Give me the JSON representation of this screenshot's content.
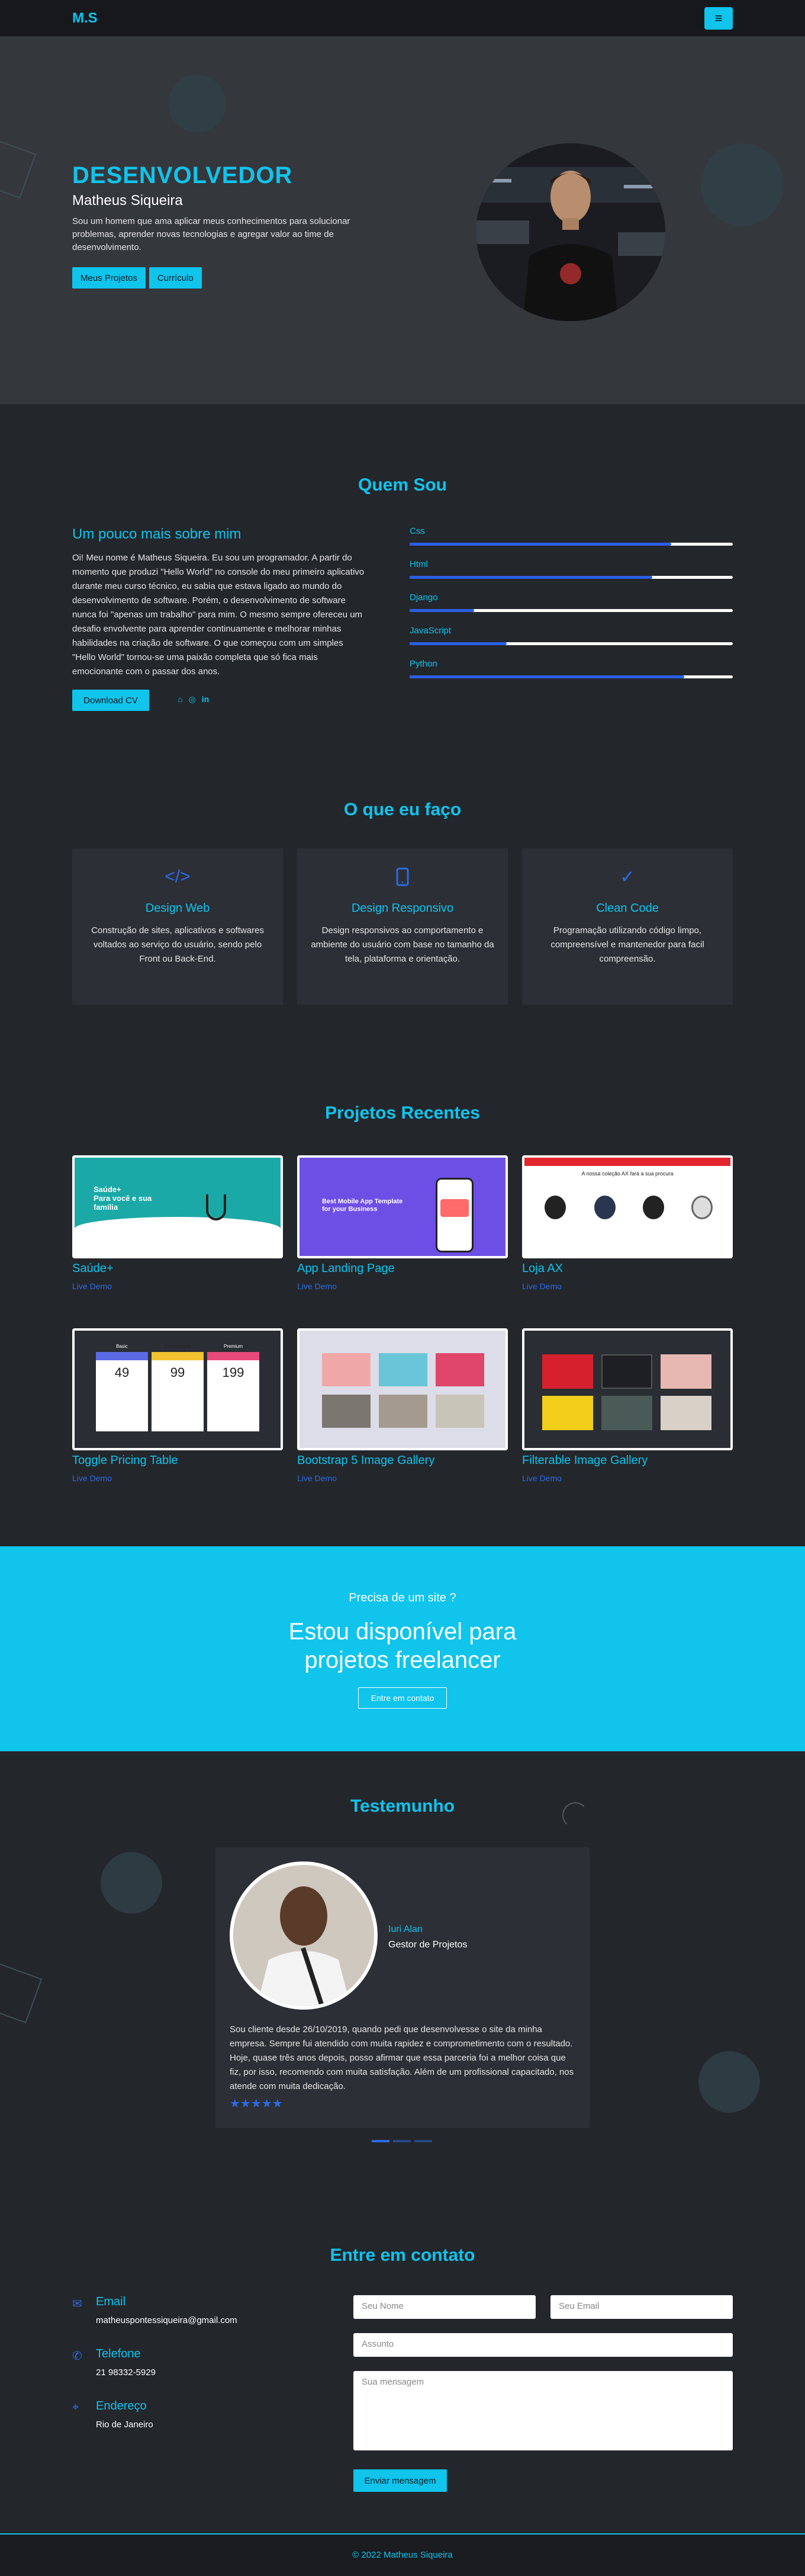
{
  "nav": {
    "logo": "M.S",
    "menu_icon": "hamburger-icon"
  },
  "hero": {
    "title": "DESENVOLVEDOR",
    "name": "Matheus Siqueira",
    "description": "Sou um homem que ama aplicar meus conhecimentos para solucionar problemas, aprender novas tecnologias e agregar valor ao time de desenvolvimento.",
    "buttons": [
      "Meus Projetos",
      "Currículo"
    ]
  },
  "about": {
    "title": "Quem Sou",
    "subtitle": "Um pouco mais sobre mim",
    "body": "Oi! Meu nome é Matheus Siqueira. Eu sou um programador. A partir do momento que produzi \"Hello World\" no console do meu primeiro aplicativo durante meu curso técnico, eu sabia que estava ligado ao mundo do desenvolvimento de software. Porém, o desenvolvimento de software nunca foi \"apenas um trabalho\" para mim. O mesmo sempre ofereceu um desafio envolvente para aprender continuamente e melhorar minhas habilidades na criação de software. O que começou com um simples \"Hello World\" tornou-se uma paixão completa que só fica mais emocionante com o passar dos anos.",
    "cv_button": "Download CV",
    "socials": [
      "github-icon",
      "instagram-icon",
      "linkedin-icon"
    ],
    "skills": [
      {
        "name": "Css",
        "level": 0.81
      },
      {
        "name": "Html",
        "level": 0.75
      },
      {
        "name": "Django",
        "level": 0.2
      },
      {
        "name": "JavaScript",
        "level": 0.3
      },
      {
        "name": "Python",
        "level": 0.85
      }
    ]
  },
  "services": {
    "title": "O que eu faço",
    "items": [
      {
        "icon": "code-icon",
        "title": "Design Web",
        "desc": "Construção de sites, aplicativos e softwares voltados ao serviço do usuário, sendo pelo Front ou Back-End."
      },
      {
        "icon": "mobile-icon",
        "title": "Design Responsivo",
        "desc": "Design responsivos ao comportamento e ambiente do usuário com base no tamanho da tela, plataforma e orientação."
      },
      {
        "icon": "check-icon",
        "title": "Clean Code",
        "desc": "Programação utilizando código limpo, compreensível e mantenedor para facil compreensão."
      }
    ]
  },
  "projects": {
    "title": "Projetos Recentes",
    "items": [
      {
        "title": "Saúde+",
        "link": "Live Demo"
      },
      {
        "title": "App Landing Page",
        "link": "Live Demo"
      },
      {
        "title": "Loja AX",
        "link": "Live Demo"
      },
      {
        "title": "Toggle Pricing Table",
        "link": "Live Demo"
      },
      {
        "title": "Bootstrap 5 Image Gallery",
        "link": "Live Demo"
      },
      {
        "title": "Filterable Image Gallery",
        "link": "Live Demo"
      }
    ],
    "thumb": {
      "saude_title": "Saúde+\nPara você e sua\nfamília",
      "app_title": "Best Mobile App Template\nfor your Business",
      "loja_text": "A nossa coleção AX fará a sua procura",
      "prices": [
        "49",
        "99",
        "199"
      ],
      "plans": [
        "Basic",
        "Professional",
        "Premium"
      ]
    }
  },
  "freelance": {
    "small": "Precisa de um site ?",
    "big": "Estou disponível para projetos freelancer",
    "button": "Entre em contato"
  },
  "testimonial": {
    "title": "Testemunho",
    "name": "Iuri Alan",
    "role": "Gestor de Projetos",
    "text": "Sou cliente desde 26/10/2019, quando pedi que desenvolvesse o site da minha empresa. Sempre fui atendido com muita rapidez e comprometimento com o resultado. Hoje, quase três anos depois, posso afirmar que essa parceria foi a melhor coisa que fiz, por isso, recomendo com muita satisfação. Além de um profissional capacitado, nos atende com muita dedicação.",
    "stars": "★★★★★"
  },
  "contact": {
    "title": "Entre em contato",
    "items": [
      {
        "icon": "mail-icon",
        "label": "Email",
        "value": "matheuspontessiqueira@gmail.com"
      },
      {
        "icon": "phone-icon",
        "label": "Telefone",
        "value": "21 98332-5929"
      },
      {
        "icon": "location-icon",
        "label": "Endereço",
        "value": "Rio de Janeiro"
      }
    ],
    "placeholders": {
      "name": "Seu Nome",
      "email": "Seu Email",
      "subject": "Assunto",
      "message": "Sua mensagem"
    },
    "send_button": "Enviar mensagem"
  },
  "footer": {
    "text": "© 2022 Matheus Siqueira"
  },
  "colors": {
    "accent": "#10c4ec",
    "blue": "#2b6be6",
    "dark": "#23262b"
  }
}
